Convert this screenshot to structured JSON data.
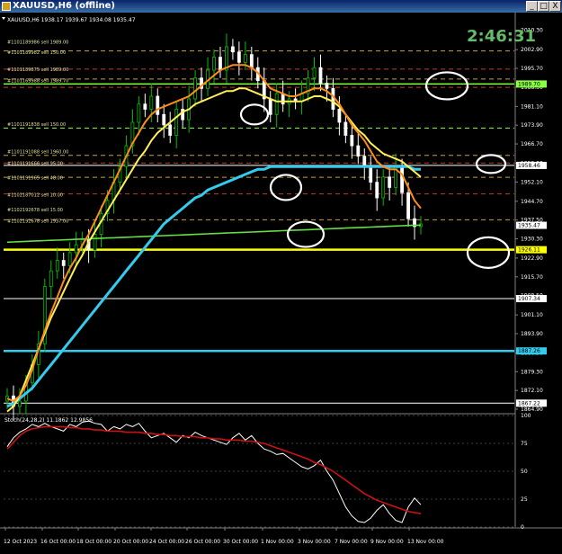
{
  "window": {
    "title": "XAUUSD,H6 (offline)",
    "buttons": [
      "_",
      "□",
      "X"
    ]
  },
  "header": {
    "symbol_line": "XAUUSD,H6  1938.17 1939.67 1934.08 1935.47"
  },
  "countdown": "2:46:31",
  "colors": {
    "background": "#000000",
    "bull_candle": "#00c000",
    "bear_candle": "#ffffff",
    "ma_fast": "#ff8c1a",
    "ma_mid": "#ffee55",
    "ma_slow": "#33ccee",
    "ma_long": "#66dd44",
    "hline_green": "#88ff44",
    "hline_yellow": "#ffff00",
    "hline_cyan": "#33ccee",
    "hline_white": "#ffffff",
    "stoch_main": "#ffffff",
    "stoch_signal": "#cc1111",
    "countdown": "#66bb66"
  },
  "price_axis": {
    "ticks": [
      "2010.30",
      "2002.90",
      "1995.70",
      "1988.50",
      "1981.10",
      "1973.90",
      "1966.70",
      "1959.30",
      "1952.10",
      "1944.70",
      "1937.50",
      "1930.30",
      "1922.90",
      "1915.70",
      "1908.50",
      "1901.10",
      "1893.90",
      "1886.50",
      "1879.30",
      "1872.10",
      "1864.90"
    ],
    "labels": [
      {
        "text": "1989.70",
        "price": 1989.7,
        "bg": "#88ff44"
      },
      {
        "text": "1958.46",
        "price": 1958.46,
        "bg": "#ffffff"
      },
      {
        "text": "1935.47",
        "price": 1935.47,
        "bg": "#ffffff"
      },
      {
        "text": "1926.11",
        "price": 1926.11,
        "bg": "#ffff00"
      },
      {
        "text": "1907.34",
        "price": 1907.34,
        "bg": "#ffffff"
      },
      {
        "text": "1887.26",
        "price": 1887.26,
        "bg": "#33ccee"
      },
      {
        "text": "1867.22",
        "price": 1867.22,
        "bg": "#ffffff"
      }
    ]
  },
  "stoch": {
    "label": "Stoch(24,28,2) 11.1862 12.9856",
    "ticks": [
      "100",
      "75",
      "50",
      "25",
      "0"
    ]
  },
  "time_axis": {
    "ticks": [
      "12 Oct 2023",
      "16 Oct 00:00",
      "18 Oct 00:00",
      "20 Oct 00:00",
      "24 Oct 00:00",
      "26 Oct 00:00",
      "30 Oct 00:00",
      "1 Nov 00:00",
      "3 Nov 00:00",
      "7 Nov 00:00",
      "9 Nov 00:00",
      "13 Nov 00:00"
    ]
  },
  "level_notes": [
    "#1101189986 sell 1989.00",
    "#1101189982 sell 150.00",
    "#1101189875 sell 1989.00",
    "#1101169988 sell 1989.70",
    "#1101191838 sell 150.00",
    "#1101191088 sell 1960.00",
    "#1101191666 sell 95.00",
    "#1101191965 sell 48.00",
    "#1102187012 sell 10.00",
    "#1102192678 sell 15.00",
    "#1102192678 sell 1937.00"
  ],
  "chart_data": {
    "type": "line",
    "title": "XAUUSD,H6",
    "price_range": [
      1864.9,
      2014.0
    ],
    "horizontal_lines": [
      {
        "price": 1989.7,
        "color": "#88ff44",
        "style": "solid"
      },
      {
        "price": 1958.46,
        "color": "#ffffff",
        "style": "solid"
      },
      {
        "price": 1926.11,
        "color": "#ffff00",
        "style": "solid"
      },
      {
        "price": 1907.34,
        "color": "#ffffff",
        "style": "solid"
      },
      {
        "price": 1887.26,
        "color": "#33ccee",
        "style": "solid"
      },
      {
        "price": 1867.22,
        "color": "#ffffff",
        "style": "solid"
      }
    ],
    "dashed_levels": [
      {
        "price": 2002.4,
        "color": "#c8a040"
      },
      {
        "price": 1995.4,
        "color": "#c04020"
      },
      {
        "price": 1991.6,
        "color": "#c8a040"
      },
      {
        "price": 1988.4,
        "color": "#c04020"
      },
      {
        "price": 1972.8,
        "color": "#88ff44"
      },
      {
        "price": 1962.3,
        "color": "#c8a040"
      },
      {
        "price": 1959.4,
        "color": "#c04020"
      },
      {
        "price": 1953.9,
        "color": "#c8a040"
      },
      {
        "price": 1947.5,
        "color": "#c04020"
      },
      {
        "price": 1937.6,
        "color": "#c8a040"
      }
    ],
    "close": [
      1870,
      1866,
      1868,
      1875,
      1882,
      1890,
      1912,
      1918,
      1922,
      1920,
      1925,
      1928,
      1930,
      1926,
      1932,
      1940,
      1945,
      1952,
      1958,
      1966,
      1975,
      1982,
      1980,
      1985,
      1978,
      1974,
      1970,
      1980,
      1976,
      1984,
      1992,
      1988,
      1995,
      2000,
      1995,
      2004,
      2002,
      1998,
      2001,
      1996,
      1991,
      1984,
      1978,
      1986,
      1982,
      1984,
      1983,
      1986,
      1992,
      1996,
      1990,
      1988,
      1980,
      1975,
      1970,
      1966,
      1962,
      1958,
      1952,
      1946,
      1954,
      1950,
      1958,
      1948,
      1938,
      1935,
      1936
    ],
    "ma_fast": [
      1869,
      1868,
      1870,
      1874,
      1880,
      1888,
      1895,
      1902,
      1908,
      1914,
      1919,
      1923,
      1928,
      1932,
      1937,
      1942,
      1947,
      1952,
      1957,
      1962,
      1967,
      1971,
      1975,
      1978,
      1980,
      1981,
      1982,
      1983,
      1984,
      1985,
      1987,
      1989,
      1991,
      1993,
      1995,
      1996,
      1997,
      1997,
      1997,
      1996,
      1994,
      1991,
      1988,
      1987,
      1986,
      1985,
      1985,
      1986,
      1987,
      1988,
      1988,
      1987,
      1985,
      1982,
      1978,
      1974,
      1971,
      1968,
      1964,
      1960,
      1958,
      1957,
      1957,
      1955,
      1950,
      1945,
      1942
    ],
    "ma_mid": [
      1864,
      1866,
      1870,
      1876,
      1882,
      1888,
      1894,
      1900,
      1905,
      1910,
      1915,
      1920,
      1924,
      1929,
      1933,
      1937,
      1941,
      1945,
      1949,
      1953,
      1957,
      1961,
      1964,
      1968,
      1971,
      1973,
      1975,
      1977,
      1979,
      1980,
      1982,
      1983,
      1984,
      1985,
      1986,
      1987,
      1987,
      1988,
      1988,
      1987,
      1986,
      1985,
      1984,
      1983,
      1983,
      1983,
      1983,
      1983,
      1984,
      1985,
      1985,
      1984,
      1983,
      1981,
      1978,
      1975,
      1972,
      1970,
      1967,
      1965,
      1963,
      1962,
      1961,
      1960,
      1958,
      1956,
      1954
    ],
    "ma_slow": [
      1866,
      1867,
      1869,
      1871,
      1873,
      1876,
      1879,
      1882,
      1885,
      1888,
      1891,
      1894,
      1897,
      1900,
      1903,
      1906,
      1909,
      1912,
      1915,
      1918,
      1921,
      1924,
      1927,
      1930,
      1933,
      1936,
      1938,
      1940,
      1942,
      1944,
      1946,
      1947,
      1949,
      1950,
      1951,
      1952,
      1953,
      1954,
      1955,
      1956,
      1957,
      1957,
      1958,
      1958,
      1958,
      1958,
      1958,
      1958,
      1958,
      1958,
      1958,
      1958,
      1958,
      1958,
      1958,
      1958,
      1958,
      1958,
      1958,
      1958,
      1958,
      1958,
      1958,
      1958,
      1958,
      1957,
      1957
    ],
    "ma_long": [
      1929,
      1929.1,
      1929.2,
      1929.3,
      1929.4,
      1929.5,
      1929.6,
      1929.7,
      1929.8,
      1929.9,
      1930,
      1930.1,
      1930.2,
      1930.3,
      1930.4,
      1930.5,
      1930.6,
      1930.7,
      1930.8,
      1930.9,
      1931,
      1931.1,
      1931.2,
      1931.3,
      1931.4,
      1931.5,
      1931.6,
      1931.7,
      1931.8,
      1931.9,
      1932,
      1932.1,
      1932.2,
      1932.3,
      1932.4,
      1932.5,
      1932.6,
      1932.7,
      1932.8,
      1932.9,
      1933,
      1933.1,
      1933.2,
      1933.3,
      1933.4,
      1933.5,
      1933.6,
      1933.7,
      1933.8,
      1933.9,
      1934,
      1934.1,
      1934.2,
      1934.3,
      1934.4,
      1934.5,
      1934.6,
      1934.7,
      1934.8,
      1934.9,
      1935,
      1935.1,
      1935.2,
      1935.3,
      1935.4,
      1935.5,
      1935.5
    ],
    "stoch_range": [
      0,
      100
    ],
    "stoch_main": [
      72,
      80,
      85,
      88,
      92,
      90,
      93,
      90,
      88,
      86,
      92,
      90,
      94,
      95,
      93,
      92,
      86,
      90,
      88,
      92,
      90,
      93,
      86,
      80,
      82,
      84,
      80,
      76,
      82,
      80,
      85,
      82,
      80,
      78,
      76,
      74,
      80,
      84,
      78,
      82,
      75,
      70,
      68,
      65,
      66,
      62,
      58,
      54,
      52,
      55,
      60,
      50,
      42,
      30,
      18,
      10,
      5,
      4,
      8,
      15,
      20,
      12,
      6,
      4,
      18,
      26,
      20
    ],
    "stoch_signal": [
      70,
      76,
      82,
      86,
      88,
      89,
      90,
      90,
      90,
      90,
      89,
      89,
      88,
      88,
      87,
      87,
      86,
      86,
      86,
      85,
      85,
      85,
      84,
      84,
      83,
      83,
      82,
      82,
      81,
      81,
      81,
      80,
      80,
      79,
      79,
      78,
      78,
      78,
      77,
      77,
      76,
      75,
      73,
      71,
      69,
      67,
      65,
      63,
      61,
      58,
      56,
      53,
      50,
      46,
      42,
      38,
      34,
      30,
      27,
      24,
      22,
      20,
      18,
      16,
      14,
      13,
      12
    ]
  }
}
